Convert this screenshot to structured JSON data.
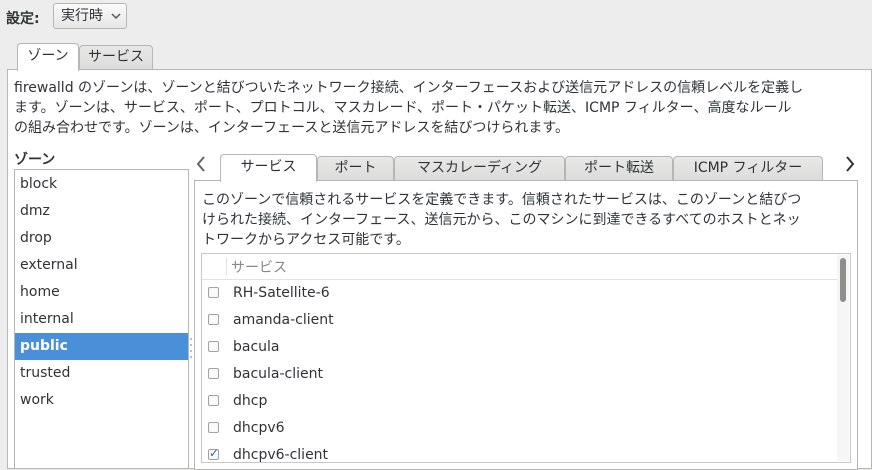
{
  "config": {
    "label": "設定:",
    "selected": "実行時"
  },
  "main_tabs": [
    {
      "label": "ゾーン",
      "active": true
    },
    {
      "label": "サービス",
      "active": false
    }
  ],
  "description": [
    "firewalld のゾーンは、ゾーンと結びついたネットワーク接続、インターフェースおよび送信元アドレスの信頼レベルを定義し",
    "ます。ゾーンは、サービス、ポート、プロトコル、マスカレード、ポート・パケット転送、ICMP フィルター、高度なルール",
    "の組み合わせです。ゾーンは、インターフェースと送信元アドレスを結びつけられます。"
  ],
  "zones": {
    "title": "ゾーン",
    "items": [
      "block",
      "dmz",
      "drop",
      "external",
      "home",
      "internal",
      "public",
      "trusted",
      "work"
    ],
    "selected": "public"
  },
  "sub_tabs": [
    {
      "label": "サービス",
      "active": true
    },
    {
      "label": "ポート",
      "active": false
    },
    {
      "label": "マスカレーディング",
      "active": false
    },
    {
      "label": "ポート転送",
      "active": false
    },
    {
      "label": "ICMP フィルター",
      "active": false
    }
  ],
  "services_desc": [
    "このゾーンで信頼されるサービスを定義できます。信頼されたサービスは、このゾーンと結びつ",
    "けられた接続、インターフェース、送信元から、このマシンに到達できるすべてのホストとネッ",
    "トワークからアクセス可能です。"
  ],
  "services": {
    "header": "サービス",
    "rows": [
      {
        "name": "RH-Satellite-6",
        "checked": false
      },
      {
        "name": "amanda-client",
        "checked": false
      },
      {
        "name": "bacula",
        "checked": false
      },
      {
        "name": "bacula-client",
        "checked": false
      },
      {
        "name": "dhcp",
        "checked": false
      },
      {
        "name": "dhcpv6",
        "checked": false
      },
      {
        "name": "dhcpv6-client",
        "checked": true
      }
    ]
  },
  "icons": {
    "left_arrow": "‹",
    "right_arrow": "›",
    "chevron": "⌄"
  }
}
